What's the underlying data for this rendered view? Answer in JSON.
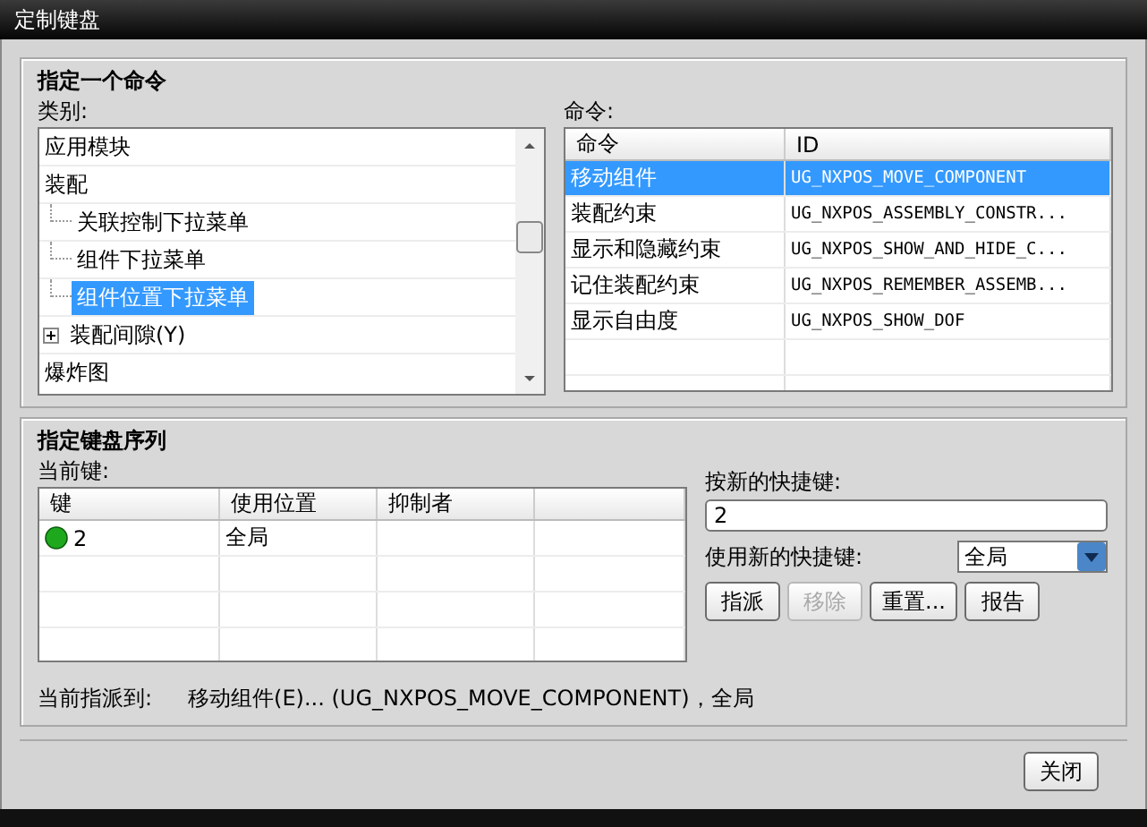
{
  "window": {
    "title": "定制键盘"
  },
  "command_group": {
    "title": "指定一个命令",
    "category_label": "类别:",
    "categories": [
      {
        "label": "应用模块",
        "selected": false
      },
      {
        "label": "装配",
        "selected": false,
        "children": [
          {
            "label": "关联控制下拉菜单",
            "selected": false
          },
          {
            "label": "组件下拉菜单",
            "selected": false
          },
          {
            "label": "组件位置下拉菜单",
            "selected": true
          },
          {
            "label": "装配间隙(Y)",
            "selected": false,
            "expanded": false
          }
        ]
      },
      {
        "label": "爆炸图",
        "selected": false
      }
    ],
    "command_label": "命令:",
    "command_table": {
      "columns": [
        "命令",
        "ID"
      ],
      "rows": [
        {
          "cells": [
            "移动组件",
            "UG_NXPOS_MOVE_COMPONENT"
          ],
          "selected": true
        },
        {
          "cells": [
            "装配约束",
            "UG_NXPOS_ASSEMBLY_CONSTR..."
          ],
          "selected": false
        },
        {
          "cells": [
            "显示和隐藏约束",
            "UG_NXPOS_SHOW_AND_HIDE_C..."
          ],
          "selected": false
        },
        {
          "cells": [
            "记住装配约束",
            "UG_NXPOS_REMEMBER_ASSEMB..."
          ],
          "selected": false
        },
        {
          "cells": [
            "显示自由度",
            "UG_NXPOS_SHOW_DOF"
          ],
          "selected": false
        }
      ]
    }
  },
  "keyboard_group": {
    "title": "指定键盘序列",
    "current_keys_label": "当前键:",
    "keys_table": {
      "columns": [
        "键",
        "使用位置",
        "抑制者"
      ],
      "rows": [
        {
          "color": "#1ea81e",
          "cells": [
            "2",
            "全局"
          ]
        }
      ]
    },
    "new_shortcut_label": "按新的快捷键:",
    "new_shortcut_value": "2",
    "use_label": "使用新的快捷键:",
    "scope": "全局",
    "buttons": [
      {
        "label": "指派",
        "disabled": false
      },
      {
        "label": "移除",
        "disabled": true
      },
      {
        "label": "重置...",
        "disabled": false
      },
      {
        "label": "报告",
        "disabled": false
      }
    ],
    "assigned_label": "当前指派到:",
    "assigned_value": "移动组件(E)... (UG_NXPOS_MOVE_COMPONENT)，全局"
  },
  "footer_buttons": [
    "关闭"
  ]
}
